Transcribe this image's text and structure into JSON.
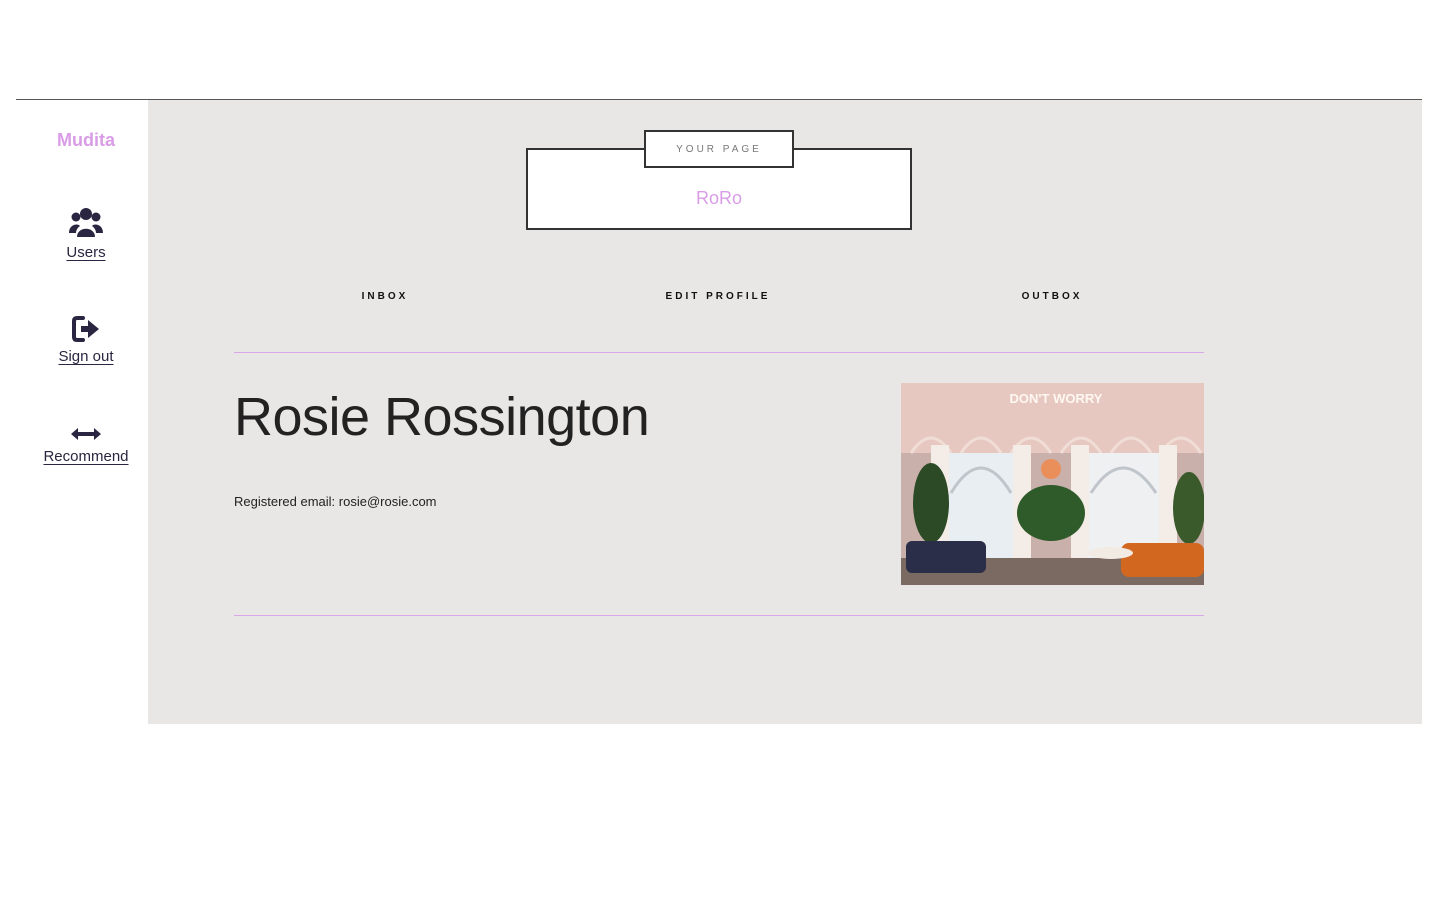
{
  "sidebar": {
    "brand": "Mudita",
    "items": [
      {
        "label": "Users",
        "icon": "users-icon"
      },
      {
        "label": "Sign out",
        "icon": "sign-out-icon"
      },
      {
        "label": "Recommend",
        "icon": "arrows-horizontal-icon"
      }
    ]
  },
  "header": {
    "tag": "YOUR PAGE",
    "username": "RoRo"
  },
  "tabs": [
    {
      "label": "INBOX"
    },
    {
      "label": "EDIT PROFILE"
    },
    {
      "label": "OUTBOX"
    }
  ],
  "profile": {
    "full_name": "Rosie Rossington",
    "email_label": "Registered email:",
    "email": "rosie@rosie.com",
    "photo_sign": "DON'T WORRY"
  },
  "colors": {
    "accent": "#d99ce6",
    "panel_bg": "#e9e7e5",
    "nav_text": "#2a2540"
  }
}
